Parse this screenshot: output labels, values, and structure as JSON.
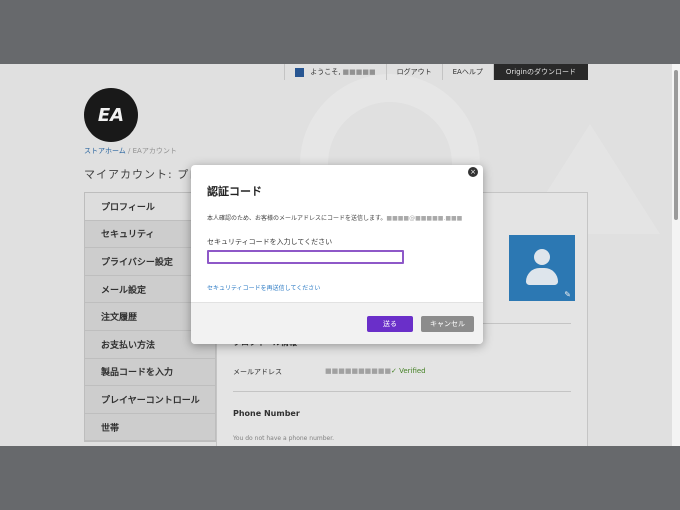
{
  "topnav": {
    "welcome": "ようこそ,",
    "username_masked": "■■■■■",
    "logout": "ログアウト",
    "help": "EAヘルプ",
    "download": "Originのダウンロード"
  },
  "logo": {
    "text": "EA"
  },
  "breadcrumb": {
    "home": "ストアホーム",
    "separator": " / ",
    "current": "EAアカウント"
  },
  "page_title": "マイアカウント: プロフ",
  "sidebar": {
    "items": [
      {
        "label": "プロフィール"
      },
      {
        "label": "セキュリティ"
      },
      {
        "label": "プライバシー設定"
      },
      {
        "label": "メール設定"
      },
      {
        "label": "注文履歴"
      },
      {
        "label": "お支払い方法"
      },
      {
        "label": "製品コードを入力"
      },
      {
        "label": "プレイヤーコントロール"
      },
      {
        "label": "世帯"
      }
    ]
  },
  "content": {
    "section_title": "プロフィール情報",
    "email_label": "メールアドレス",
    "email_value_masked": "■■■■■■■■■■",
    "verified": "✓ Verified",
    "phone_title": "Phone Number",
    "phone_note": "You do not have a phone number."
  },
  "modal": {
    "title": "認証コード",
    "description": "本人確認のため、お客様のメールアドレスにコードを送信します。",
    "email_masked": "■■■■@■■■■■.■■■",
    "code_label": "セキュリティコードを入力してください",
    "code_value": "",
    "resend_link": "セキュリティコードを再送信してください",
    "send_label": "送る",
    "cancel_label": "キャンセル",
    "close_glyph": "×"
  },
  "colors": {
    "accent_purple": "#6a2fc9",
    "link_blue": "#2b7ac4",
    "avatar_blue": "#2f7fbd"
  }
}
